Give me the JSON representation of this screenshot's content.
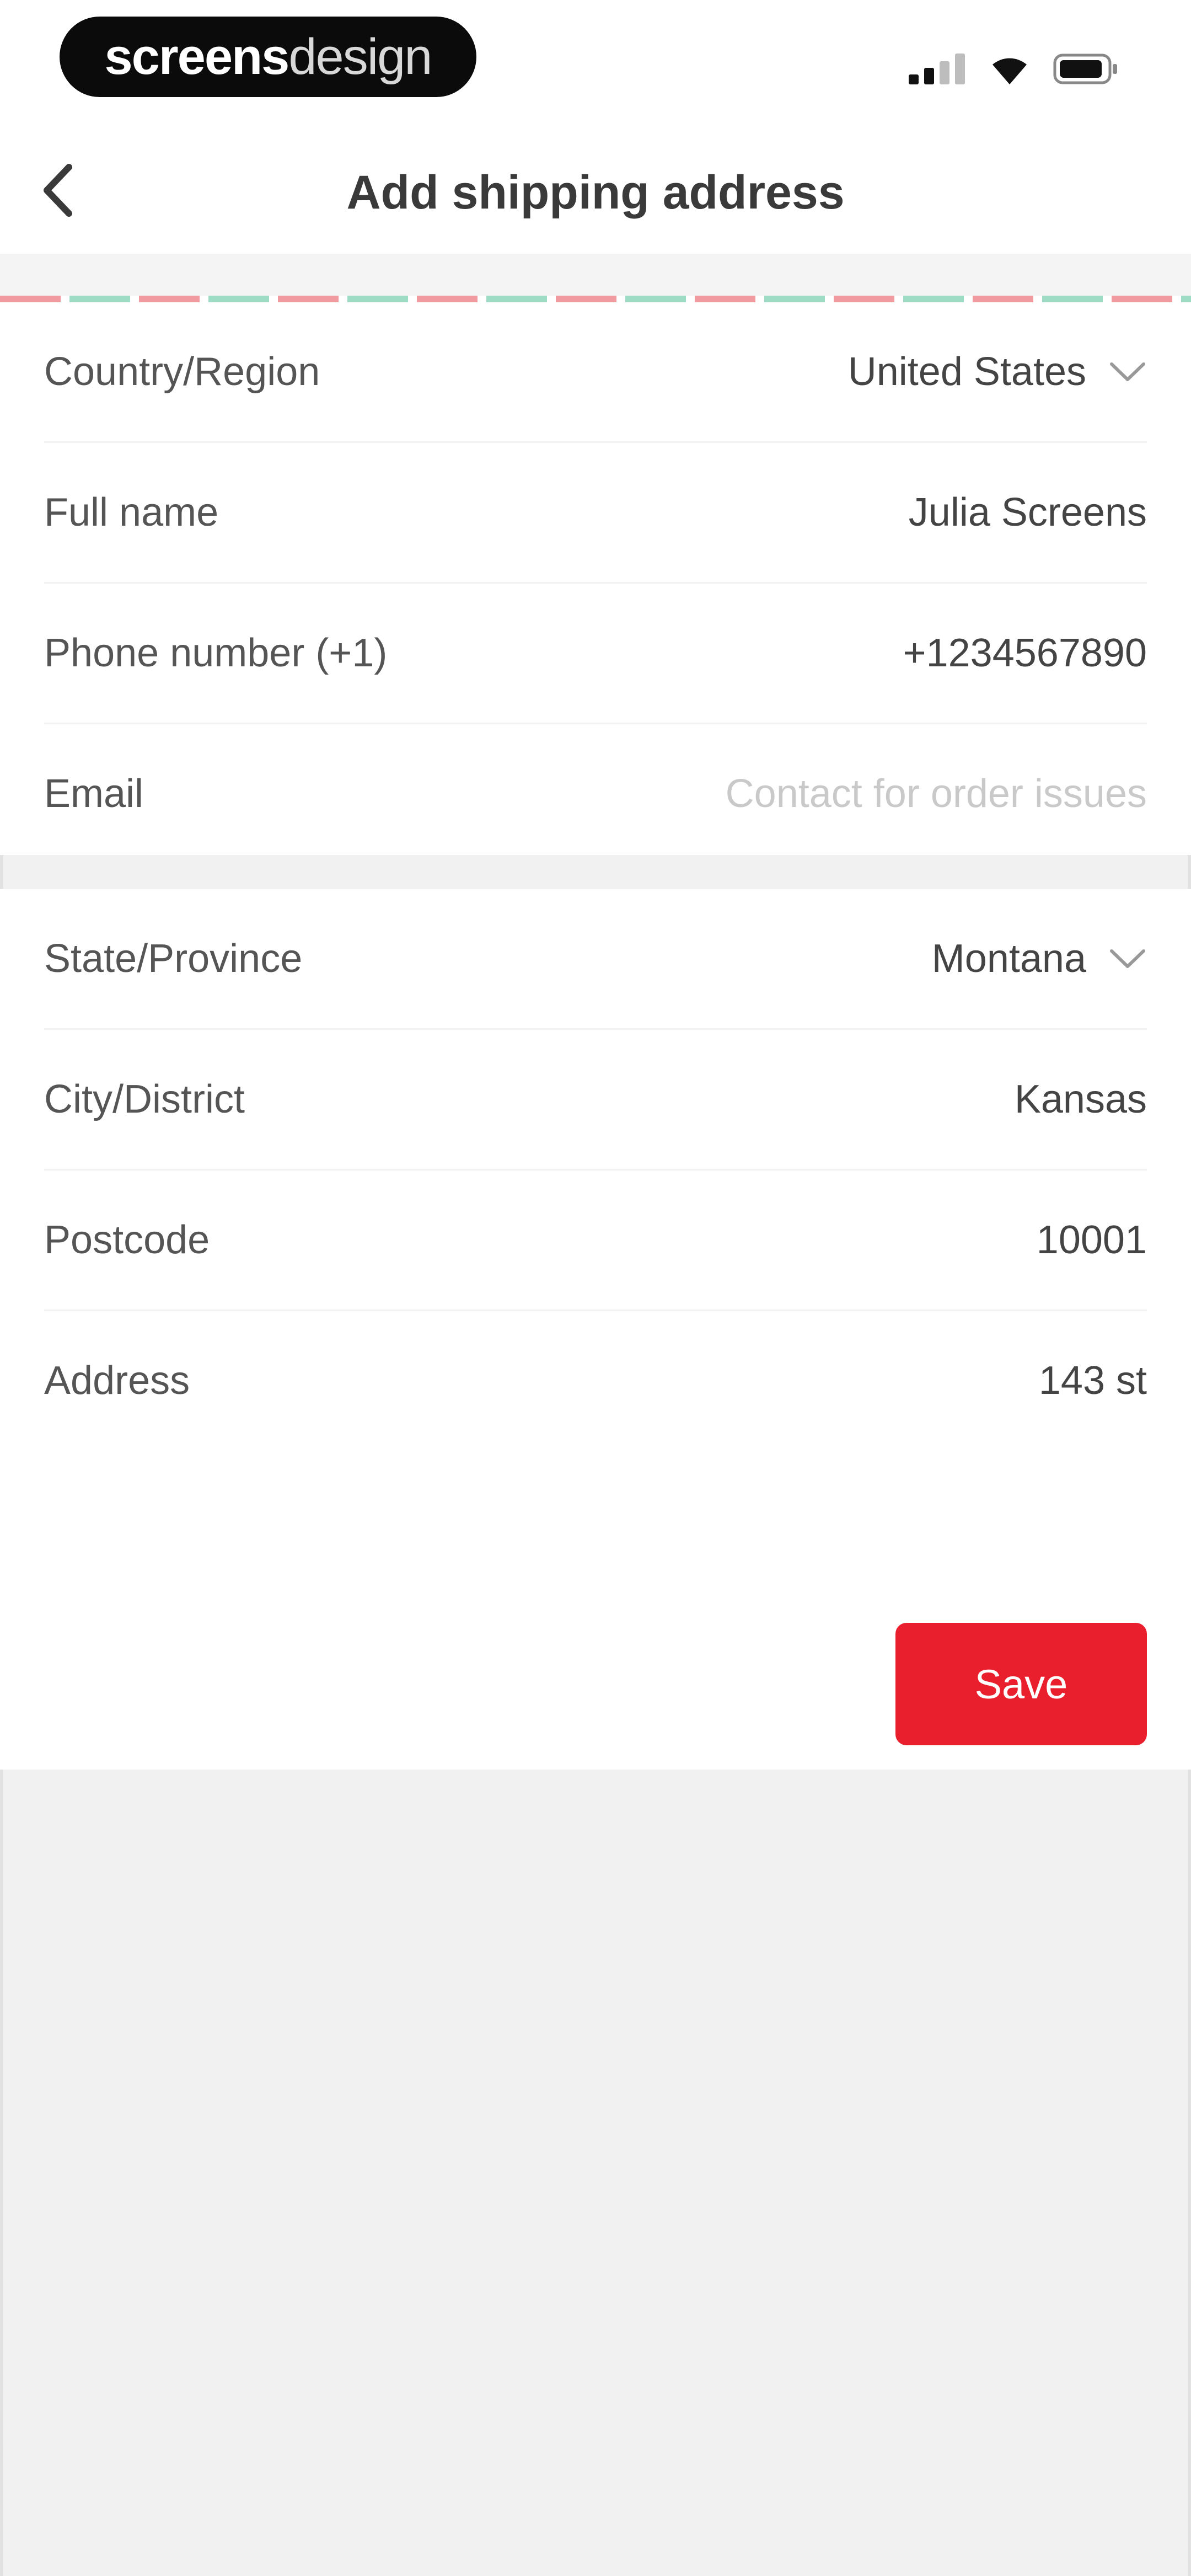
{
  "status_bar": {
    "brand_bold": "screens",
    "brand_light": "design",
    "icons": [
      "signal-icon",
      "wifi-icon",
      "battery-icon"
    ]
  },
  "header": {
    "title": "Add shipping address",
    "back_icon": "chevron-left-icon"
  },
  "contact_section": {
    "rows": [
      {
        "label": "Country/Region",
        "value": "United States",
        "dropdown": true
      },
      {
        "label": "Full name",
        "value": "Julia Screens"
      },
      {
        "label": "Phone number (+1)",
        "value": "+1234567890"
      },
      {
        "label": "Email",
        "value": "",
        "placeholder": "Contact for order issues"
      }
    ]
  },
  "address_section": {
    "rows": [
      {
        "label": "State/Province",
        "value": "Montana",
        "dropdown": true
      },
      {
        "label": "City/District",
        "value": "Kansas"
      },
      {
        "label": "Postcode",
        "value": "10001"
      },
      {
        "label": "Address",
        "value": "143 st"
      }
    ]
  },
  "actions": {
    "save_label": "Save"
  },
  "colors": {
    "accent": "#ea1f2e",
    "stripe_red": "#f19aa0",
    "stripe_green": "#9fdcc6",
    "background": "#f1f1f1"
  }
}
